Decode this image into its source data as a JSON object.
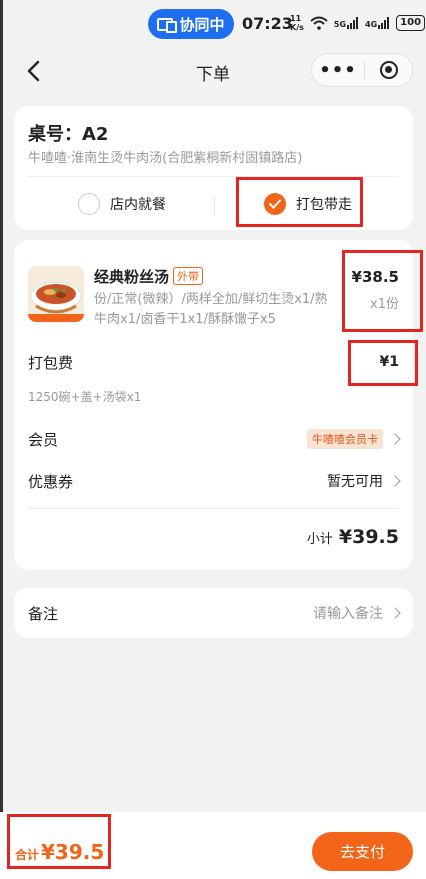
{
  "status_bar": {
    "cast_label": "协同中",
    "time": "07:23",
    "net_speed_top": "11",
    "net_speed_unit": "K/s",
    "signal1": "5G",
    "signal2": "4G",
    "battery": "100"
  },
  "nav": {
    "title": "下单",
    "more_label": "•••"
  },
  "order": {
    "table_label": "桌号：A2",
    "store_name": "牛喳喳·淮南生烫牛肉汤(合肥紫桐新村固镇路店)",
    "options": [
      {
        "label": "店内就餐",
        "selected": false
      },
      {
        "label": "打包带走",
        "selected": true
      }
    ]
  },
  "item": {
    "name": "经典粉丝汤",
    "tag": "外带",
    "spec": "份/正常(微辣）/两样全加/鲜切生烫x1/熟牛肉x1/卤香干1x1/酥酥馓子x5",
    "price": "¥38.5",
    "qty": "x1份"
  },
  "packing": {
    "label": "打包费",
    "price": "¥1",
    "detail": "1250碗+盖+汤袋x1"
  },
  "member": {
    "label": "会员",
    "badge": "牛喳喳会员卡"
  },
  "coupon": {
    "label": "优惠券",
    "value": "暂无可用"
  },
  "subtotal": {
    "label": "小计",
    "value": "¥39.5"
  },
  "remark": {
    "label": "备注",
    "placeholder": "请输入备注"
  },
  "footer": {
    "total_label": "合计",
    "total_value": "¥39.5",
    "pay_label": "去支付"
  },
  "colors": {
    "accent": "#f26418",
    "annotation_red": "#e52521",
    "cast_blue": "#1e6ff0"
  }
}
